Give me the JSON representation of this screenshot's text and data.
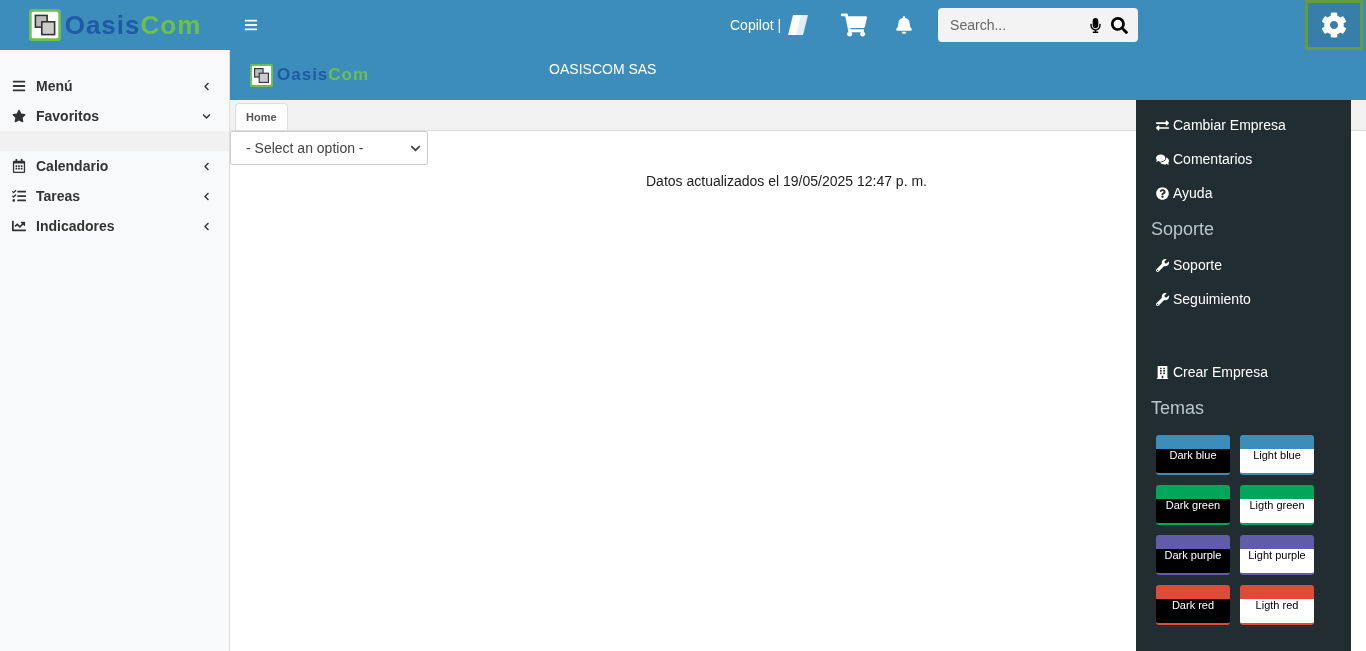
{
  "header": {
    "logo": {
      "part_1": "Oasis",
      "part_2": "Com"
    },
    "copilot": "Copilot |",
    "search": {
      "placeholder": "Search..."
    },
    "settings": {
      "selected": true
    }
  },
  "sidebar": {
    "items": [
      {
        "label": "Menú",
        "expanded": false
      },
      {
        "label": "Favoritos",
        "expanded": true
      },
      {
        "label": "Calendario",
        "expanded": false
      },
      {
        "label": "Tareas",
        "expanded": false
      },
      {
        "label": "Indicadores",
        "expanded": false
      }
    ]
  },
  "banner": {
    "logo": {
      "part_1": "Oasis",
      "part_2": "Com"
    },
    "company": "OASISCOM SAS"
  },
  "tabs": [
    {
      "label": "Home",
      "selected": true
    }
  ],
  "select": {
    "value": "- Select an option -"
  },
  "updated": "Datos actualizados el 19/05/2025 12:47 p. m.",
  "control_panel": {
    "items": [
      {
        "kind": "link",
        "label": "Cambiar Empresa"
      },
      {
        "kind": "link",
        "label": "Comentarios"
      },
      {
        "kind": "link",
        "label": "Ayuda"
      },
      {
        "kind": "heading",
        "label": "Soporte"
      },
      {
        "kind": "link",
        "label": "Soporte"
      },
      {
        "kind": "link",
        "label": "Seguimiento"
      },
      {
        "kind": "spacer_link",
        "label": "Crear Empresa"
      },
      {
        "kind": "heading",
        "label": "Temas"
      }
    ],
    "themes": [
      {
        "label": "Dark blue",
        "kind": "dark",
        "color": "#3c8dbc"
      },
      {
        "label": "Light blue",
        "kind": "light",
        "color": "#3c8dbc"
      },
      {
        "label": "Dark green",
        "kind": "dark",
        "color": "#00a65a"
      },
      {
        "label": "Ligth green",
        "kind": "light",
        "color": "#00a65a"
      },
      {
        "label": "Dark purple",
        "kind": "dark",
        "color": "#605ca8"
      },
      {
        "label": "Light purple",
        "kind": "light",
        "color": "#605ca8"
      },
      {
        "label": "Dark red",
        "kind": "dark",
        "color": "#dd4b39"
      },
      {
        "label": "Ligth red",
        "kind": "light",
        "color": "#dd4b39"
      }
    ]
  }
}
